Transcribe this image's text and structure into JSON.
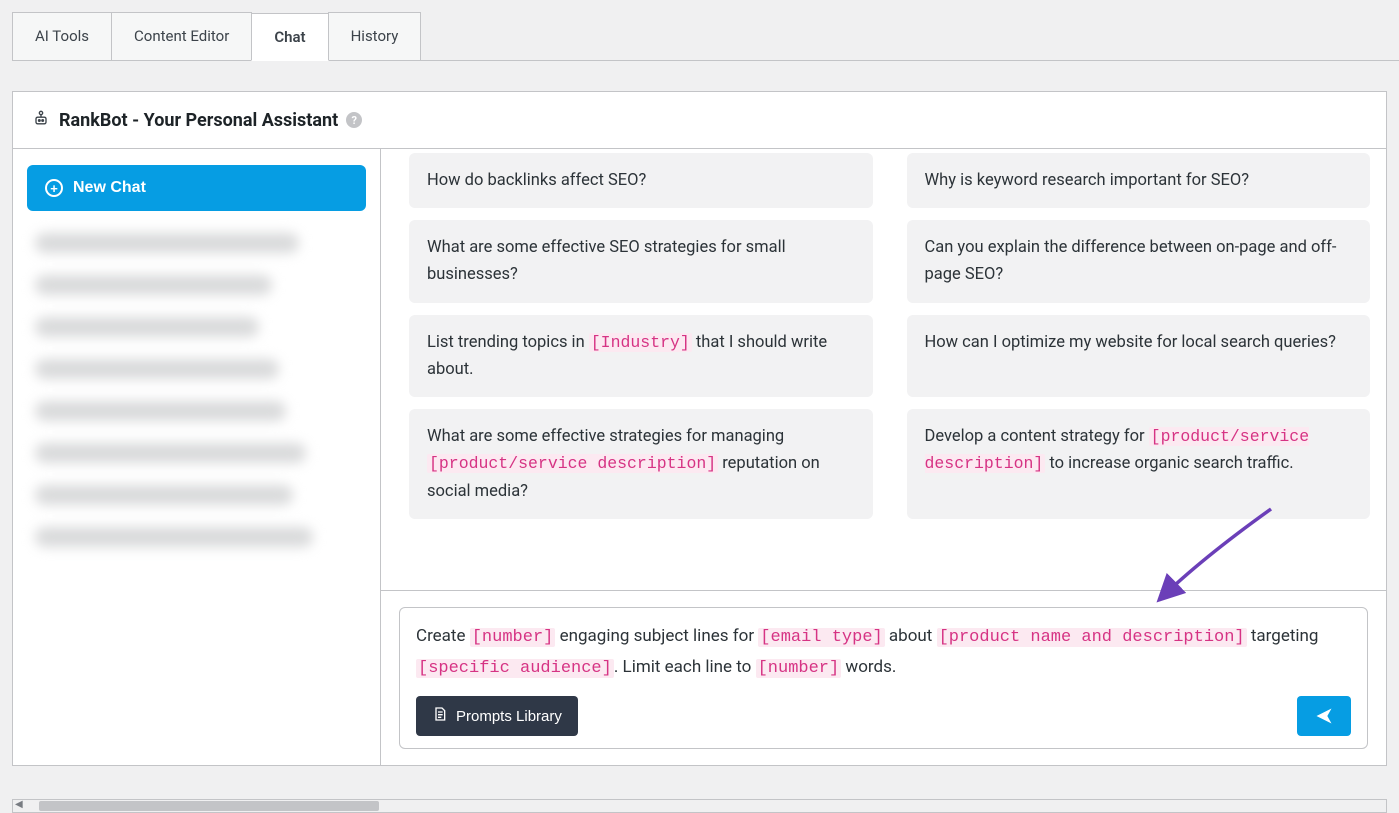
{
  "tabs": [
    {
      "label": "AI Tools",
      "active": false
    },
    {
      "label": "Content Editor",
      "active": false
    },
    {
      "label": "Chat",
      "active": true
    },
    {
      "label": "History",
      "active": false
    }
  ],
  "panel": {
    "title": "RankBot - Your Personal Assistant"
  },
  "sidebar": {
    "new_chat_label": "New Chat"
  },
  "prompts": {
    "row1": {
      "left": {
        "segments": [
          {
            "t": "How do backlinks affect SEO?"
          }
        ]
      },
      "right": {
        "segments": [
          {
            "t": "Why is keyword research important for SEO?"
          }
        ]
      }
    },
    "row2": {
      "left": {
        "segments": [
          {
            "t": "What are some effective SEO strategies for small businesses?"
          }
        ]
      },
      "right": {
        "segments": [
          {
            "t": "Can you explain the difference between on-page and off-page SEO?"
          }
        ]
      }
    },
    "row3": {
      "left": {
        "segments": [
          {
            "t": "List trending topics in "
          },
          {
            "p": "[Industry]"
          },
          {
            "t": " that I should write about."
          }
        ]
      },
      "right": {
        "segments": [
          {
            "t": "How can I optimize my website for local search queries?"
          }
        ]
      }
    },
    "row4": {
      "left": {
        "segments": [
          {
            "t": "What are some effective strategies for managing "
          },
          {
            "p": "[product/service description]"
          },
          {
            "t": " reputation on social media?"
          }
        ]
      },
      "right": {
        "segments": [
          {
            "t": "Develop a content strategy for "
          },
          {
            "p": "[product/service description]"
          },
          {
            "t": " to increase organic search traffic."
          }
        ]
      }
    }
  },
  "composer": {
    "segments": [
      {
        "t": "Create "
      },
      {
        "p": "[number]"
      },
      {
        "t": " engaging subject lines for "
      },
      {
        "p": "[email type]"
      },
      {
        "t": " about "
      },
      {
        "p": "[product name and description]"
      },
      {
        "t": " targeting "
      },
      {
        "p": "[specific audience]"
      },
      {
        "t": ". Limit each line to "
      },
      {
        "p": "[number]"
      },
      {
        "t": " words."
      }
    ],
    "prompts_library_label": "Prompts Library"
  }
}
